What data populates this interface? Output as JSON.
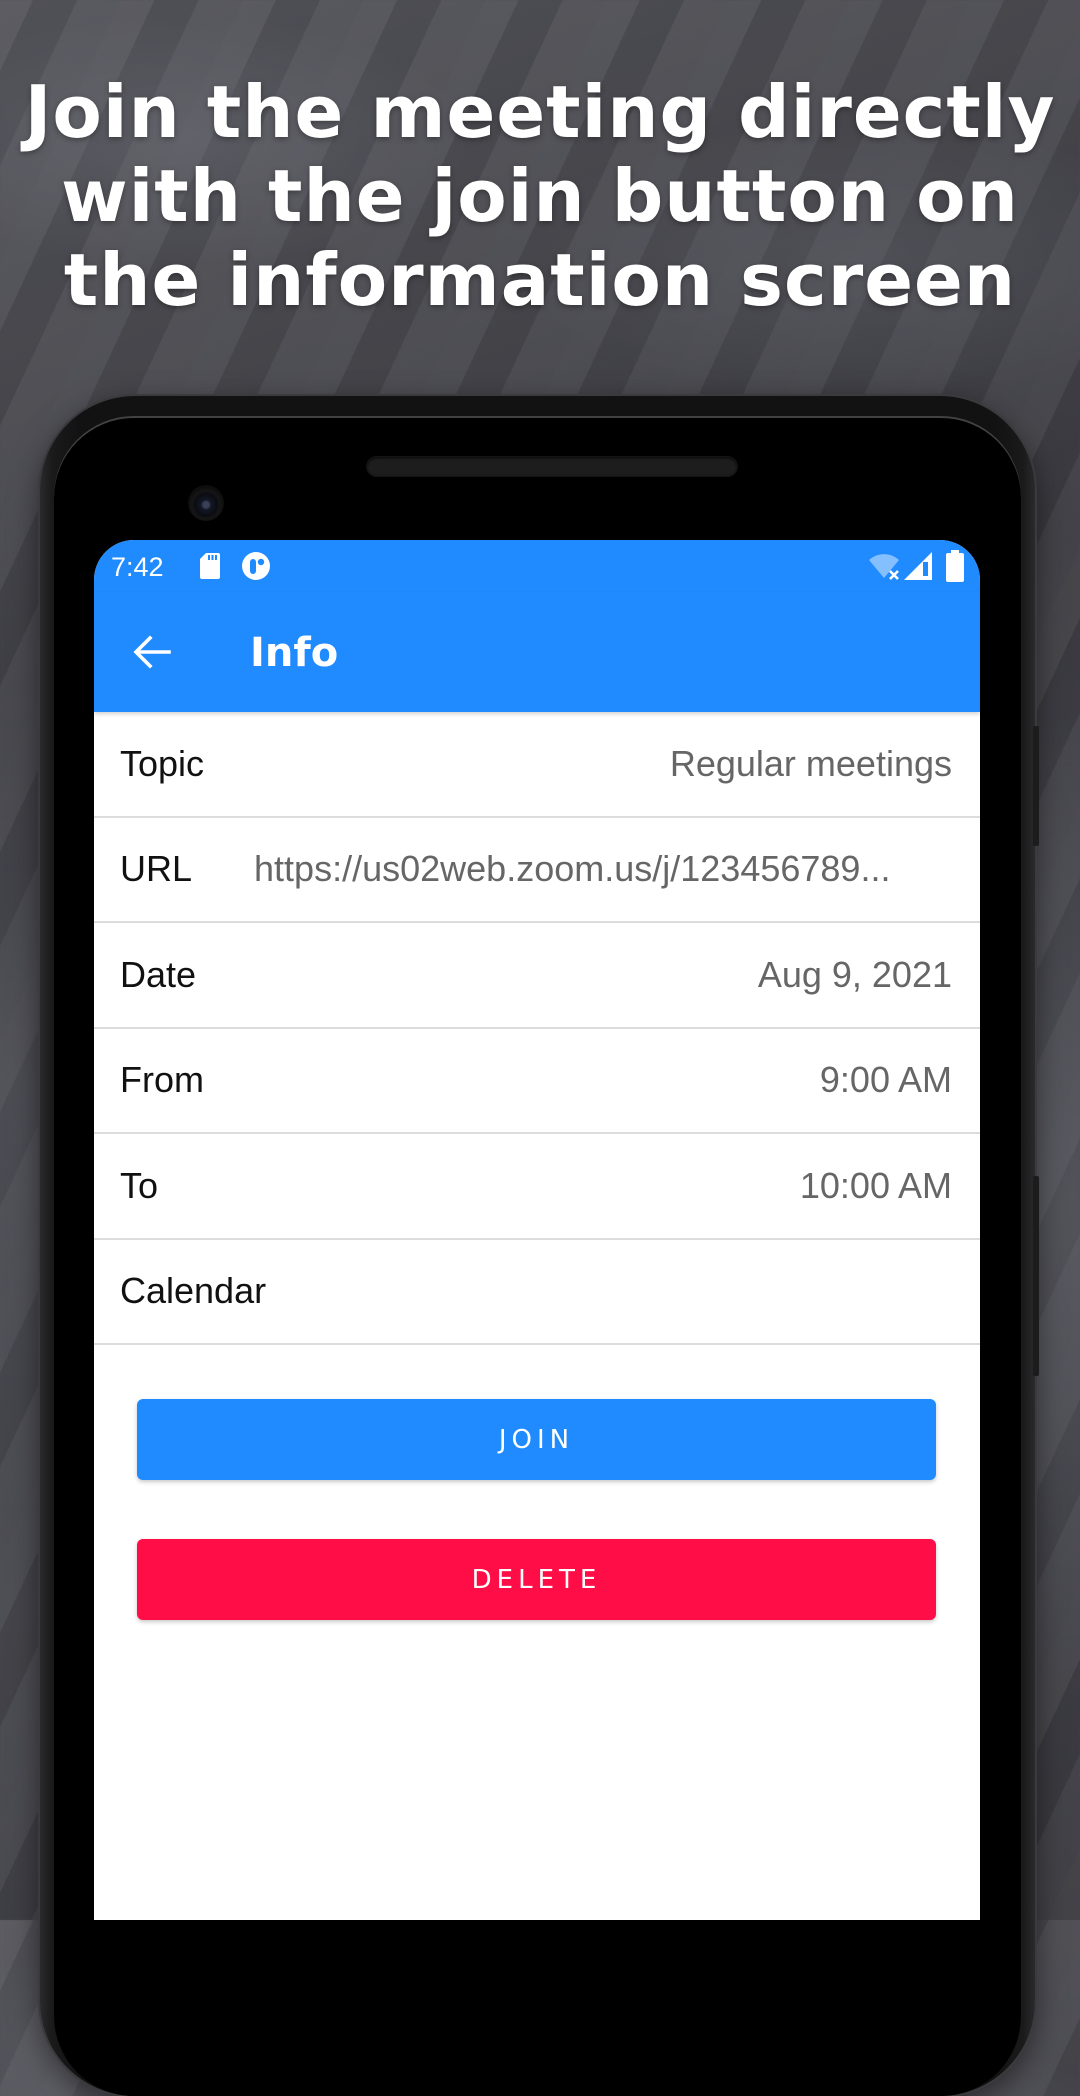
{
  "headline": {
    "lines": [
      "Join the meeting directly",
      "with the join button on",
      "the information screen"
    ]
  },
  "status_bar": {
    "time": "7:42",
    "left_icons": [
      "sd-card-icon",
      "app-notification-icon"
    ],
    "right_icons": [
      "wifi-off-icon",
      "cellular-signal-icon",
      "battery-icon"
    ]
  },
  "app_bar": {
    "back_icon": "arrow-back-icon",
    "title": "Info"
  },
  "info": {
    "rows": [
      {
        "label": "Topic",
        "value": "Regular meetings"
      },
      {
        "label": "URL",
        "value": "https://us02web.zoom.us/j/123456789..."
      },
      {
        "label": "Date",
        "value": "Aug 9, 2021"
      },
      {
        "label": "From",
        "value": "9:00 AM"
      },
      {
        "label": "To",
        "value": "10:00 AM"
      },
      {
        "label": "Calendar",
        "value": ""
      }
    ]
  },
  "actions": {
    "join_label": "JOIN",
    "delete_label": "DELETE"
  },
  "colors": {
    "primary": "#1F8BFF",
    "danger": "#FF0D46",
    "label_text": "#111111",
    "value_text": "#666666",
    "divider": "#DCDCDC"
  }
}
